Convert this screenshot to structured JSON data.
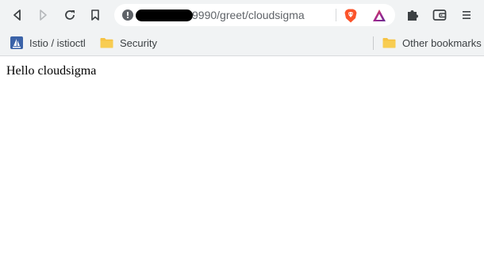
{
  "toolbar": {
    "back": {
      "icon": "back-arrow-icon",
      "enabled": true
    },
    "forward": {
      "icon": "forward-arrow-icon",
      "enabled": false
    },
    "reload": {
      "icon": "reload-icon"
    },
    "bookmark": {
      "icon": "bookmark-icon"
    },
    "extensions": {
      "icon": "puzzle-piece-icon"
    },
    "wallet": {
      "icon": "wallet-icon"
    },
    "menu": {
      "icon": "hamburger-menu-icon"
    }
  },
  "omnibox": {
    "security_icon": "info-icon",
    "url_visible": "9990/greet/cloudsigma",
    "url_host_redacted": true,
    "shield_icon": "brave-shields-icon",
    "rewards_icon": "brave-rewards-icon"
  },
  "bookmarks_bar": {
    "items": [
      {
        "label": "Istio / istioctl",
        "icon": "sail-favicon-icon"
      },
      {
        "label": "Security",
        "icon": "folder-icon"
      }
    ],
    "other": {
      "label": "Other bookmarks",
      "icon": "folder-icon"
    }
  },
  "page": {
    "text": "Hello cloudsigma"
  },
  "colors": {
    "chrome_bg": "#f1f3f4",
    "omnibox_bg": "#ffffff",
    "folder": "#f6c344",
    "brave_orange": "#fb542b",
    "favicon_blue": "#3b63a8"
  }
}
